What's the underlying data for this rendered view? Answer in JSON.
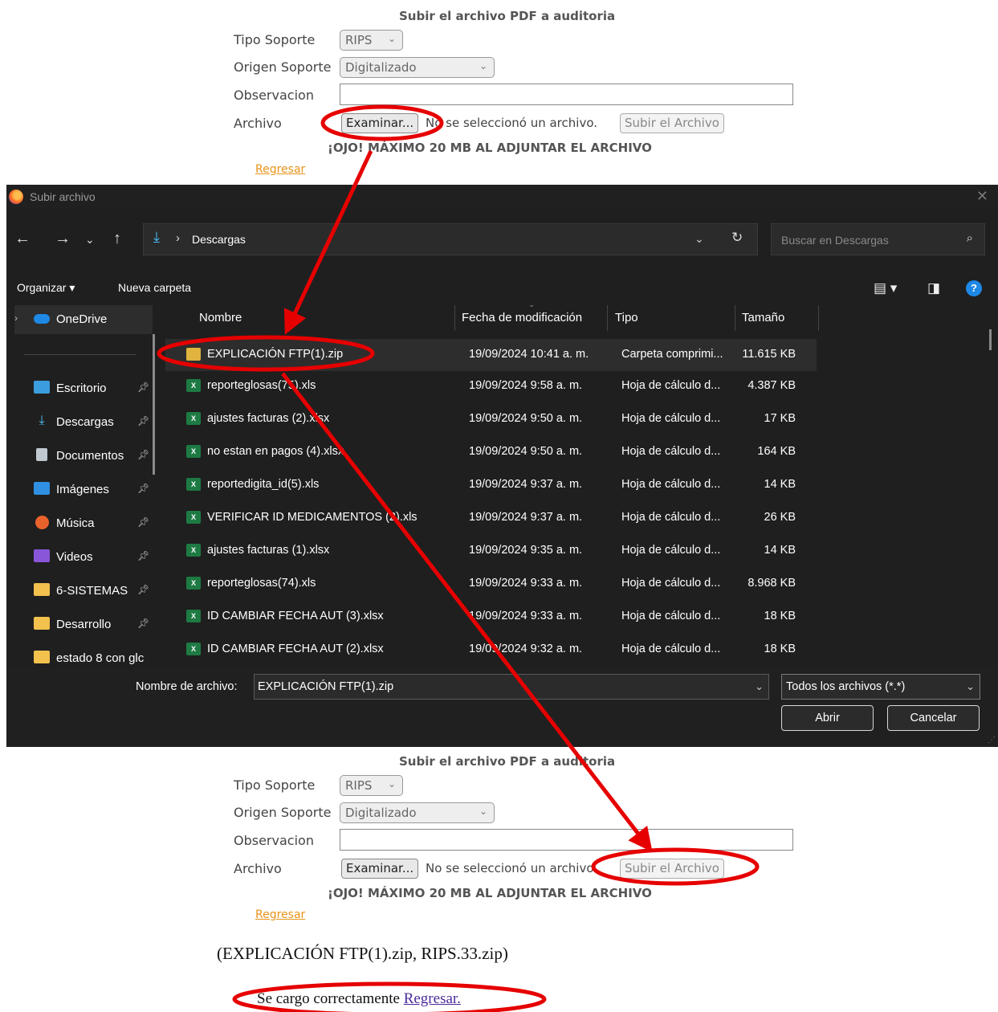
{
  "top_form": {
    "title": "Subir el archivo PDF a auditoria",
    "tipo_soporte_label": "Tipo Soporte",
    "tipo_soporte_value": "RIPS",
    "origen_soporte_label": "Origen Soporte",
    "origen_soporte_value": "Digitalizado",
    "observacion_label": "Observacion",
    "archivo_label": "Archivo",
    "browse_label": "Examinar...",
    "no_file_text": "No se seleccionó un archivo.",
    "upload_label": "Subir el Archivo",
    "warning": "¡OJO! MÁXIMO 20 MB AL ADJUNTAR EL ARCHIVO",
    "back_link": "Regresar"
  },
  "dialog": {
    "title": "Subir archivo",
    "address_path": "Descargas",
    "search_placeholder": "Buscar en Descargas",
    "organize_label": "Organizar ▾",
    "new_folder_label": "Nueva carpeta",
    "sidebar": [
      {
        "label": "OneDrive",
        "icon": "cloud-icon",
        "color": "#1e88e5"
      },
      {
        "label": "Escritorio",
        "icon": "desktop-icon",
        "color": "#3b9dde"
      },
      {
        "label": "Descargas",
        "icon": "download-icon",
        "color": "#4cc2ff"
      },
      {
        "label": "Documentos",
        "icon": "document-icon",
        "color": "#c0c8d0"
      },
      {
        "label": "Imágenes",
        "icon": "image-icon",
        "color": "#2f8fe0"
      },
      {
        "label": "Música",
        "icon": "music-icon",
        "color": "#e8622c"
      },
      {
        "label": "Videos",
        "icon": "video-icon",
        "color": "#8a56d9"
      },
      {
        "label": "6-SISTEMAS",
        "icon": "folder-icon",
        "color": "#f2c14e"
      },
      {
        "label": "Desarrollo",
        "icon": "folder-icon",
        "color": "#f2c14e"
      },
      {
        "label": "estado 8 con glc",
        "icon": "folder-icon",
        "color": "#f2c14e"
      }
    ],
    "columns": [
      "Nombre",
      "Fecha de modificación",
      "Tipo",
      "Tamaño"
    ],
    "files": [
      {
        "name": "EXPLICACIÓN FTP(1).zip",
        "date": "19/09/2024 10:41 a. m.",
        "type": "Carpeta comprimi...",
        "size": "11.615 KB",
        "kind": "zip"
      },
      {
        "name": "reporteglosas(75).xls",
        "date": "19/09/2024 9:58 a. m.",
        "type": "Hoja de cálculo d...",
        "size": "4.387 KB",
        "kind": "xls"
      },
      {
        "name": "ajustes facturas (2).xlsx",
        "date": "19/09/2024 9:50 a. m.",
        "type": "Hoja de cálculo d...",
        "size": "17 KB",
        "kind": "xlsx"
      },
      {
        "name": "no estan en pagos (4).xlsx",
        "date": "19/09/2024 9:50 a. m.",
        "type": "Hoja de cálculo d...",
        "size": "164 KB",
        "kind": "xlsx"
      },
      {
        "name": "reportedigita_id(5).xls",
        "date": "19/09/2024 9:37 a. m.",
        "type": "Hoja de cálculo d...",
        "size": "14 KB",
        "kind": "xls"
      },
      {
        "name": "VERIFICAR ID MEDICAMENTOS (2).xls",
        "date": "19/09/2024 9:37 a. m.",
        "type": "Hoja de cálculo d...",
        "size": "26 KB",
        "kind": "xls"
      },
      {
        "name": "ajustes facturas (1).xlsx",
        "date": "19/09/2024 9:35 a. m.",
        "type": "Hoja de cálculo d...",
        "size": "14 KB",
        "kind": "xlsx"
      },
      {
        "name": "reporteglosas(74).xls",
        "date": "19/09/2024 9:33 a. m.",
        "type": "Hoja de cálculo d...",
        "size": "8.968 KB",
        "kind": "xls"
      },
      {
        "name": "ID CAMBIAR FECHA AUT (3).xlsx",
        "date": "19/09/2024 9:33 a. m.",
        "type": "Hoja de cálculo d...",
        "size": "18 KB",
        "kind": "xlsx"
      },
      {
        "name": "ID CAMBIAR FECHA AUT (2).xlsx",
        "date": "19/09/2024 9:32 a. m.",
        "type": "Hoja de cálculo d...",
        "size": "18 KB",
        "kind": "xlsx"
      }
    ],
    "filename_label": "Nombre de archivo:",
    "filename_value": "EXPLICACIÓN FTP(1).zip",
    "filetype_value": "Todos los archivos (*.*)",
    "open_label": "Abrir",
    "cancel_label": "Cancelar"
  },
  "bottom_form": {
    "title": "Subir el archivo PDF a auditoria",
    "tipo_soporte_label": "Tipo Soporte",
    "tipo_soporte_value": "RIPS",
    "origen_soporte_label": "Origen Soporte",
    "origen_soporte_value": "Digitalizado",
    "observacion_label": "Observacion",
    "archivo_label": "Archivo",
    "browse_label": "Examinar...",
    "no_file_text": "No se seleccionó un archivo.",
    "upload_label": "Subir el Archivo",
    "warning": "¡OJO! MÁXIMO 20 MB AL ADJUNTAR EL ARCHIVO",
    "back_link": "Regresar"
  },
  "result": {
    "files_text": "(EXPLICACIÓN FTP(1).zip, RIPS.33.zip)",
    "success_text": "Se cargo correctamente ",
    "success_link": "Regresar."
  },
  "annotation_color": "#e60000"
}
